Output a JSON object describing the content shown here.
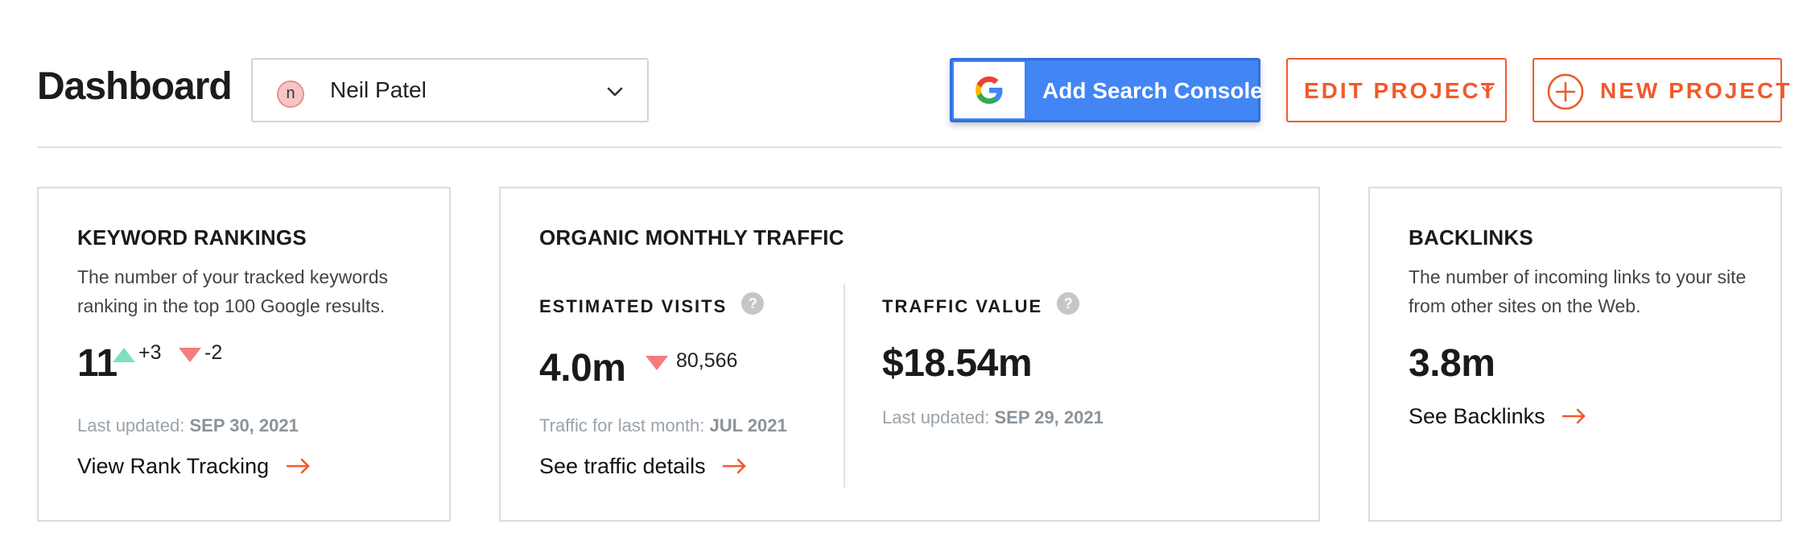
{
  "header": {
    "title": "Dashboard",
    "project": {
      "avatar_letter": "n",
      "name": "Neil Patel"
    },
    "add_search_console_label": "Add Search Console",
    "edit_project_label": "EDIT PROJECT",
    "new_project_label": "NEW PROJECT"
  },
  "colors": {
    "accent": "#f05a2c",
    "google_blue": "#4285f4",
    "trend_up": "#7fe0c0",
    "trend_down": "#f47c7c"
  },
  "cards": {
    "keyword_rankings": {
      "title": "KEYWORD RANKINGS",
      "description": "The number of your tracked keywords ranking in the top 100 Google results.",
      "value": "11",
      "up_change": "+3",
      "down_change": "-2",
      "updated_label": "Last updated:",
      "updated_date": "SEP 30, 2021",
      "link_label": "View Rank Tracking"
    },
    "organic_traffic": {
      "title": "ORGANIC MONTHLY TRAFFIC",
      "estimated_visits": {
        "label": "ESTIMATED VISITS",
        "value": "4.0m",
        "change": "80,566",
        "note_label": "Traffic for last month:",
        "note_date": "JUL 2021"
      },
      "traffic_value": {
        "label": "TRAFFIC VALUE",
        "value": "$18.54m",
        "updated_label": "Last updated:",
        "updated_date": "SEP 29, 2021"
      },
      "link_label": "See traffic details"
    },
    "backlinks": {
      "title": "BACKLINKS",
      "description": "The number of incoming links to your site from other sites on the Web.",
      "value": "3.8m",
      "link_label": "See Backlinks"
    }
  },
  "icons": {
    "help": "?",
    "dropdown": "chevron-down-icon",
    "link_arrow": "arrow-right-icon"
  }
}
